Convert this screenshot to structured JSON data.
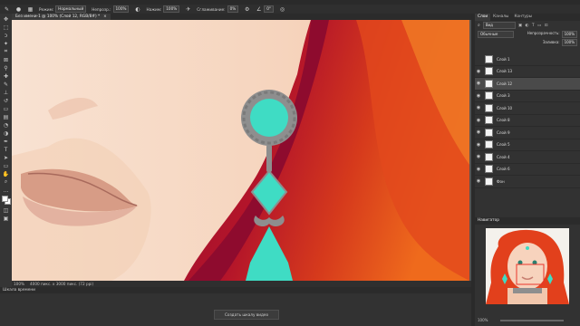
{
  "toolbar_options": {
    "mode_label": "Режим:",
    "mode_value": "Нормальный",
    "opacity_label": "Непрозр.:",
    "opacity_value": "100%",
    "flow_label": "Нажим:",
    "flow_value": "100%",
    "smoothing_label": "Сглаживание:",
    "smoothing_value": "0%",
    "angle_value": "0°"
  },
  "document": {
    "tab_title": "Без имени-1 @ 100% (Слой 12, RGB/8#) *",
    "close_glyph": "×"
  },
  "statusbar": {
    "zoom": "100%",
    "doc_size": "4000 пикс. x 3000 пикс. (72 ppi)"
  },
  "timeline": {
    "title": "Шкала времени",
    "create_button": "Создать шкалу видео"
  },
  "layers_panel": {
    "tabs": [
      "Слои",
      "Каналы",
      "Контуры"
    ],
    "kind_label": "Вид",
    "blend_mode": "Обычные",
    "opacity_label": "Непрозрачность:",
    "opacity_value": "100%",
    "fill_label": "Заливка:",
    "fill_value": "100%",
    "layers": [
      {
        "name": "Слой 1",
        "visible": false
      },
      {
        "name": "Слой 13",
        "visible": true
      },
      {
        "name": "Слой 12",
        "visible": true,
        "selected": true
      },
      {
        "name": "Слой 3",
        "visible": true
      },
      {
        "name": "Слой 10",
        "visible": true
      },
      {
        "name": "Слой 8",
        "visible": true
      },
      {
        "name": "Слой 9",
        "visible": true
      },
      {
        "name": "Слой 5",
        "visible": true
      },
      {
        "name": "Слой 4",
        "visible": true
      },
      {
        "name": "Слой 6",
        "visible": true
      },
      {
        "name": "Фон",
        "visible": true
      }
    ]
  },
  "navigator": {
    "title": "Навигатор",
    "zoom": "100%"
  },
  "colors": {
    "app_dark": "#2f2f2f",
    "panel": "#323232",
    "skin": "#f6d8c4",
    "hair_dark_red": "#8a0a28",
    "hair_orange": "#e85a1a",
    "earring_teal": "#3fdcc4",
    "earring_metal": "#8b8b8b"
  }
}
